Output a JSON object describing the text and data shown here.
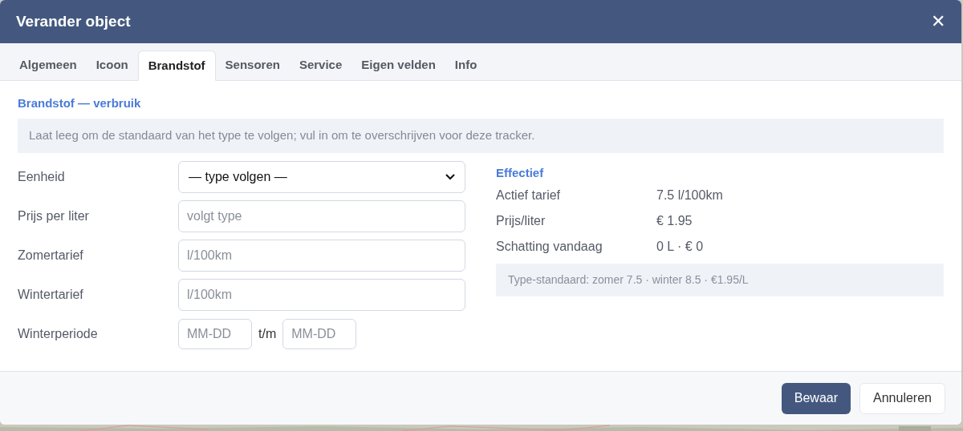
{
  "dialog": {
    "title": "Verander object",
    "close": "✕"
  },
  "tabs": [
    {
      "label": "Algemeen",
      "selected": false
    },
    {
      "label": "Icoon",
      "selected": false
    },
    {
      "label": "Brandstof",
      "selected": true
    },
    {
      "label": "Sensoren",
      "selected": false
    },
    {
      "label": "Service",
      "selected": false
    },
    {
      "label": "Eigen velden",
      "selected": false
    },
    {
      "label": "Info",
      "selected": false
    }
  ],
  "section_title": "Brandstof — verbruik",
  "hint": "Laat leeg om de standaard van het type te volgen; vul in om te overschrijven voor deze tracker.",
  "form": [
    {
      "kind": "select",
      "label": "Eenheid",
      "value": "— type volgen —"
    },
    {
      "kind": "input",
      "label": "Prijs per liter",
      "placeholder": "volgt type"
    },
    {
      "kind": "input",
      "label": "Zomertarief",
      "placeholder": "l/100km"
    },
    {
      "kind": "input",
      "label": "Wintertarief",
      "placeholder": "l/100km"
    },
    {
      "kind": "range",
      "label": "Winterperiode",
      "from_placeholder": "MM-DD",
      "separator": "t/m",
      "to_placeholder": "MM-DD"
    }
  ],
  "effective": {
    "title": "Effectief",
    "rows": [
      {
        "label": "Actief tarief",
        "value": "7.5 l/100km"
      },
      {
        "label": "Prijs/liter",
        "value": "€ 1.95"
      },
      {
        "label": "Schatting vandaag",
        "value": "0 L · € 0"
      }
    ],
    "note": "Type-standaard: zomer 7.5 · winter 8.5 · €1.95/L"
  },
  "buttons": [
    {
      "label": "Bewaar",
      "kind": "primary"
    },
    {
      "label": "Annuleren",
      "kind": "secondary"
    }
  ]
}
